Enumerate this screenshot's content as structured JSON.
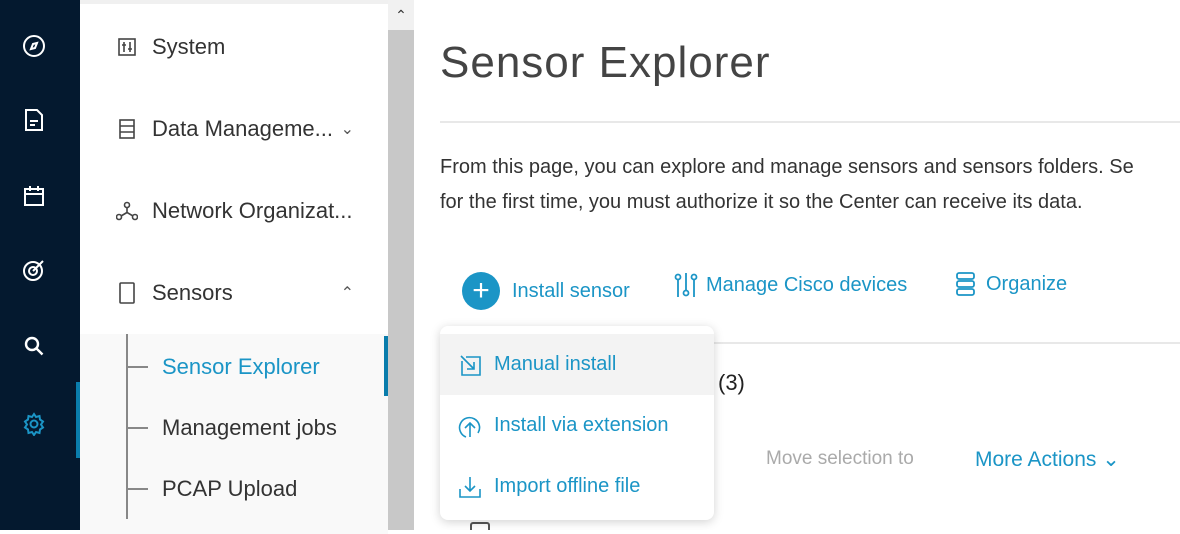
{
  "rail": {
    "icons": [
      "compass-icon",
      "document-icon",
      "calendar-icon",
      "target-icon",
      "search-icon",
      "gear-icon"
    ]
  },
  "sidebar": {
    "items": [
      {
        "label": "System"
      },
      {
        "label": "Data Manageme..."
      },
      {
        "label": "Network Organizat..."
      },
      {
        "label": "Sensors"
      }
    ],
    "sub_items": [
      {
        "label": "Sensor Explorer"
      },
      {
        "label": "Management jobs"
      },
      {
        "label": "PCAP Upload"
      }
    ]
  },
  "main": {
    "title": "Sensor Explorer",
    "description": [
      "From this page, you can explore and manage sensors and sensors folders. Se",
      "for the first time, you must authorize it so the Center can receive its data."
    ],
    "toolbar": {
      "install": "Install sensor",
      "manage": "Manage Cisco devices",
      "organize": "Organize"
    },
    "dropdown": [
      {
        "label": "Manual install"
      },
      {
        "label": "Install via extension"
      },
      {
        "label": "Import offline file"
      }
    ],
    "count": "(3)",
    "move_selection": "Move selection to",
    "more_actions": "More Actions"
  },
  "colors": {
    "accent": "#1b95c6",
    "rail": "#04192f"
  }
}
